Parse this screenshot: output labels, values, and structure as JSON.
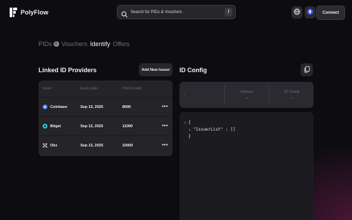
{
  "app": {
    "name": "PolyFlow"
  },
  "search": {
    "placeholder": "Search for PIDs & Vouchers",
    "shortcut": "/"
  },
  "header": {
    "connect_label": "Connect",
    "globe_icon": "globe-icon",
    "network_icon": "ethereum-icon"
  },
  "tabs": [
    {
      "label": "PIDs",
      "badge": "1",
      "active": false
    },
    {
      "label": "Vouchers",
      "active": false
    },
    {
      "label": "Identify",
      "active": true
    },
    {
      "label": "Offers",
      "active": false
    }
  ],
  "providers": {
    "title": "Linked ID Providers",
    "add_label": "Add New Issuer",
    "columns": [
      "Issuer",
      "Expiry date",
      "Points eared"
    ],
    "rows": [
      {
        "issuer": "Coinbase",
        "expiry": "Sep 13, 2025",
        "points": "8000",
        "more": "•••",
        "icon_color": "#2f6bff"
      },
      {
        "issuer": "Bitget",
        "expiry": "Sep 13, 2025",
        "points": "11000",
        "more": "•••",
        "icon_color": "#2ec7d8"
      },
      {
        "issuer": "Okx",
        "expiry": "Sep 13, 2025",
        "points": "10000",
        "more": "•••",
        "icon_color": "#cfcfd4"
      }
    ]
  },
  "config": {
    "title": "ID Config",
    "first_cell": "-",
    "address_label": "Address",
    "address_value": "-",
    "vc_label": "VC Config",
    "vc_value": "-",
    "code": {
      "open": "{",
      "key": "\"IssuerList\"",
      "colon": " : ",
      "value": "[]",
      "close": "}"
    }
  },
  "colors": {
    "background": "#0d0d10",
    "panel": "#242429",
    "accent_glow": "#781e55"
  }
}
